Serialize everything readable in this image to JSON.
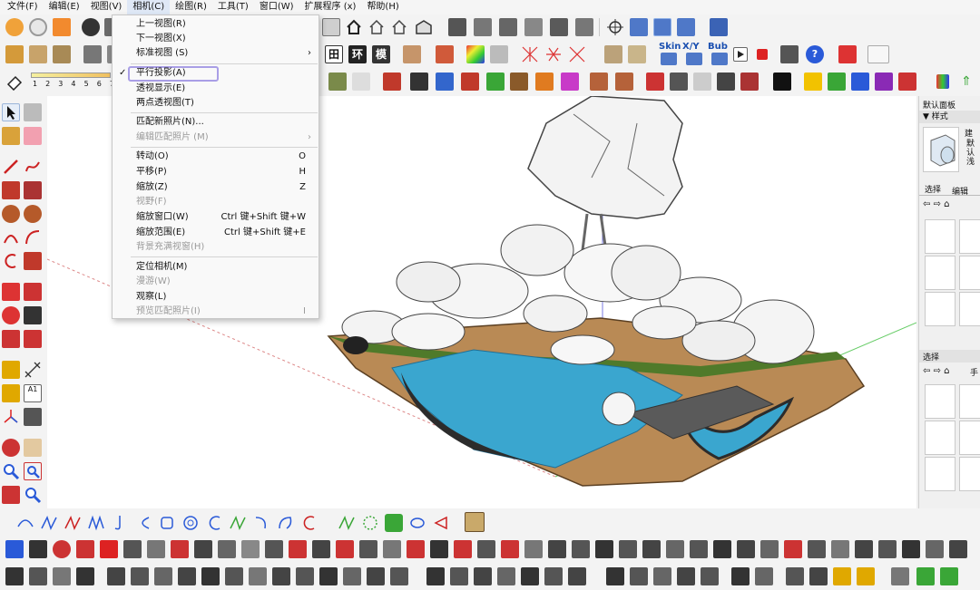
{
  "menubar": {
    "items": [
      "文件(F)",
      "编辑(E)",
      "视图(V)",
      "相机(C)",
      "绘图(R)",
      "工具(T)",
      "窗口(W)",
      "扩展程序 (x)",
      "帮助(H)"
    ]
  },
  "camera_menu": {
    "items": [
      {
        "label": "上一视图(R)",
        "shortcut": "",
        "enabled": true,
        "checked": false,
        "submenu": false
      },
      {
        "label": "下一视图(X)",
        "shortcut": "",
        "enabled": true,
        "checked": false,
        "submenu": false
      },
      {
        "label": "标准视图 (S)",
        "shortcut": "",
        "enabled": true,
        "checked": false,
        "submenu": true
      },
      {
        "label": "平行投影(A)",
        "shortcut": "",
        "enabled": true,
        "checked": true,
        "submenu": false,
        "highlighted": true
      },
      {
        "label": "透视显示(E)",
        "shortcut": "",
        "enabled": true,
        "checked": false,
        "submenu": false
      },
      {
        "label": "两点透视图(T)",
        "shortcut": "",
        "enabled": true,
        "checked": false,
        "submenu": false
      },
      {
        "label": "匹配新照片(N)...",
        "shortcut": "",
        "enabled": true,
        "checked": false,
        "submenu": false
      },
      {
        "label": "编辑匹配照片 (M)",
        "shortcut": "",
        "enabled": false,
        "checked": false,
        "submenu": true
      },
      {
        "label": "转动(O)",
        "shortcut": "O",
        "enabled": true,
        "checked": false,
        "submenu": false
      },
      {
        "label": "平移(P)",
        "shortcut": "H",
        "enabled": true,
        "checked": false,
        "submenu": false
      },
      {
        "label": "缩放(Z)",
        "shortcut": "Z",
        "enabled": true,
        "checked": false,
        "submenu": false
      },
      {
        "label": "视野(F)",
        "shortcut": "",
        "enabled": false,
        "checked": false,
        "submenu": false
      },
      {
        "label": "缩放窗口(W)",
        "shortcut": "Ctrl 键+Shift 键+W",
        "enabled": true,
        "checked": false,
        "submenu": false
      },
      {
        "label": "缩放范围(E)",
        "shortcut": "Ctrl 键+Shift 键+E",
        "enabled": true,
        "checked": false,
        "submenu": false
      },
      {
        "label": "背景充满视窗(H)",
        "shortcut": "",
        "enabled": false,
        "checked": false,
        "submenu": false
      },
      {
        "label": "定位相机(M)",
        "shortcut": "",
        "enabled": true,
        "checked": false,
        "submenu": false
      },
      {
        "label": "漫游(W)",
        "shortcut": "",
        "enabled": false,
        "checked": false,
        "submenu": false
      },
      {
        "label": "观察(L)",
        "shortcut": "",
        "enabled": true,
        "checked": false,
        "submenu": false
      },
      {
        "label": "预览匹配照片(I)",
        "shortcut": "I",
        "enabled": false,
        "checked": false,
        "submenu": false
      }
    ]
  },
  "toolbar": {
    "row2_labels": [
      "田",
      "环",
      "模"
    ],
    "skin_label": "Skin",
    "xy_label": "X/Y",
    "bub_label": "Bub",
    "layer_numbers": [
      "1",
      "2",
      "3",
      "4",
      "5",
      "6",
      "7"
    ]
  },
  "tray": {
    "title": "默认面板",
    "section": "▼ 样式",
    "style_name": "建",
    "style_desc": "默认浅",
    "tabs": [
      "选择",
      "编辑"
    ],
    "select_label": "选择",
    "select_label2": "选择",
    "style_label2": "手"
  },
  "colors": {
    "accent_highlight": "#a99ee6",
    "water": "#3aa6cf",
    "soil": "#b98a55",
    "grass": "#4f7a2a"
  }
}
